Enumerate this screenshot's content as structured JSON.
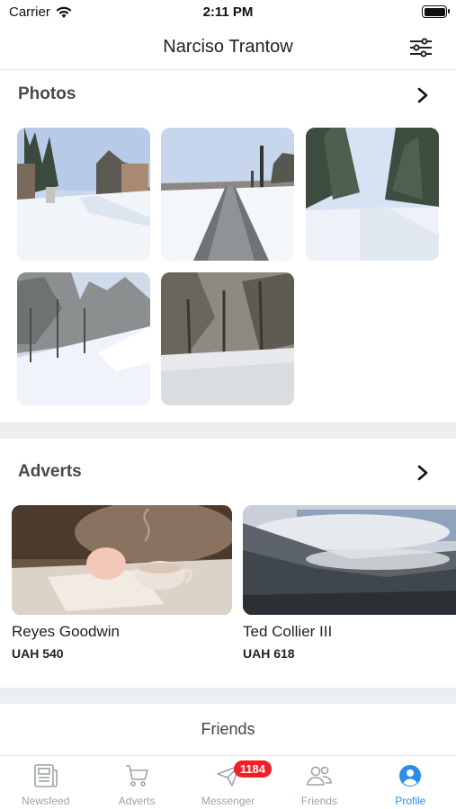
{
  "status_bar": {
    "carrier": "Carrier",
    "time": "2:11 PM"
  },
  "header": {
    "title": "Narciso Trantow",
    "filter_icon": "sliders-icon"
  },
  "photos": {
    "title": "Photos",
    "items": [
      "snowy-street-photo",
      "snowy-path-photo",
      "snowy-forest-road-photo",
      "snowy-park-photo",
      "snowy-trees-photo"
    ]
  },
  "adverts": {
    "title": "Adverts",
    "items": [
      {
        "name": "Reyes Goodwin",
        "price": "UAH 540",
        "image": "tea-cup-photo"
      },
      {
        "name": "Ted Collier III",
        "price": "UAH 618",
        "image": "misty-mountains-photo"
      }
    ]
  },
  "friends": {
    "title": "Friends"
  },
  "tab_bar": {
    "tabs": [
      {
        "label": "Newsfeed",
        "icon": "newspaper-icon"
      },
      {
        "label": "Adverts",
        "icon": "cart-icon"
      },
      {
        "label": "Messenger",
        "icon": "paper-plane-icon",
        "badge": "1184"
      },
      {
        "label": "Friends",
        "icon": "people-icon"
      },
      {
        "label": "Profile",
        "icon": "profile-icon",
        "active": true
      }
    ]
  },
  "colors": {
    "accent": "#2a8ee6",
    "badge": "#f0202a",
    "divider": "#eceff1"
  }
}
